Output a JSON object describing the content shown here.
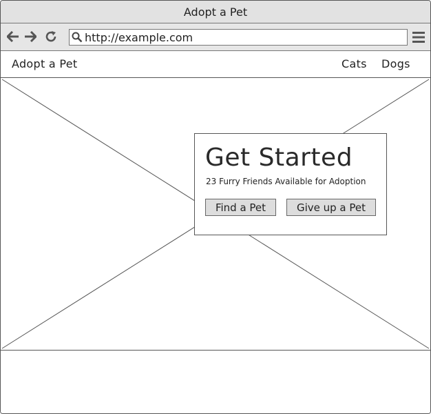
{
  "window": {
    "title": "Adopt a Pet"
  },
  "toolbar": {
    "back_icon": "arrow-left-icon",
    "forward_icon": "arrow-right-icon",
    "reload_icon": "reload-icon",
    "search_icon": "search-icon",
    "menu_icon": "hamburger-menu-icon",
    "url": "http://example.com"
  },
  "site_nav": {
    "brand": "Adopt a Pet",
    "links": [
      "Cats",
      "Dogs"
    ]
  },
  "hero": {
    "image": "image-placeholder",
    "card": {
      "title": "Get Started",
      "subtitle": "23 Furry Friends Available for Adoption",
      "buttons": [
        "Find a Pet",
        "Give up a Pet"
      ]
    }
  },
  "colors": {
    "chrome_bg": "#e2e2e2",
    "border": "#555555",
    "button_bg": "#dddddd",
    "text": "#222222"
  }
}
